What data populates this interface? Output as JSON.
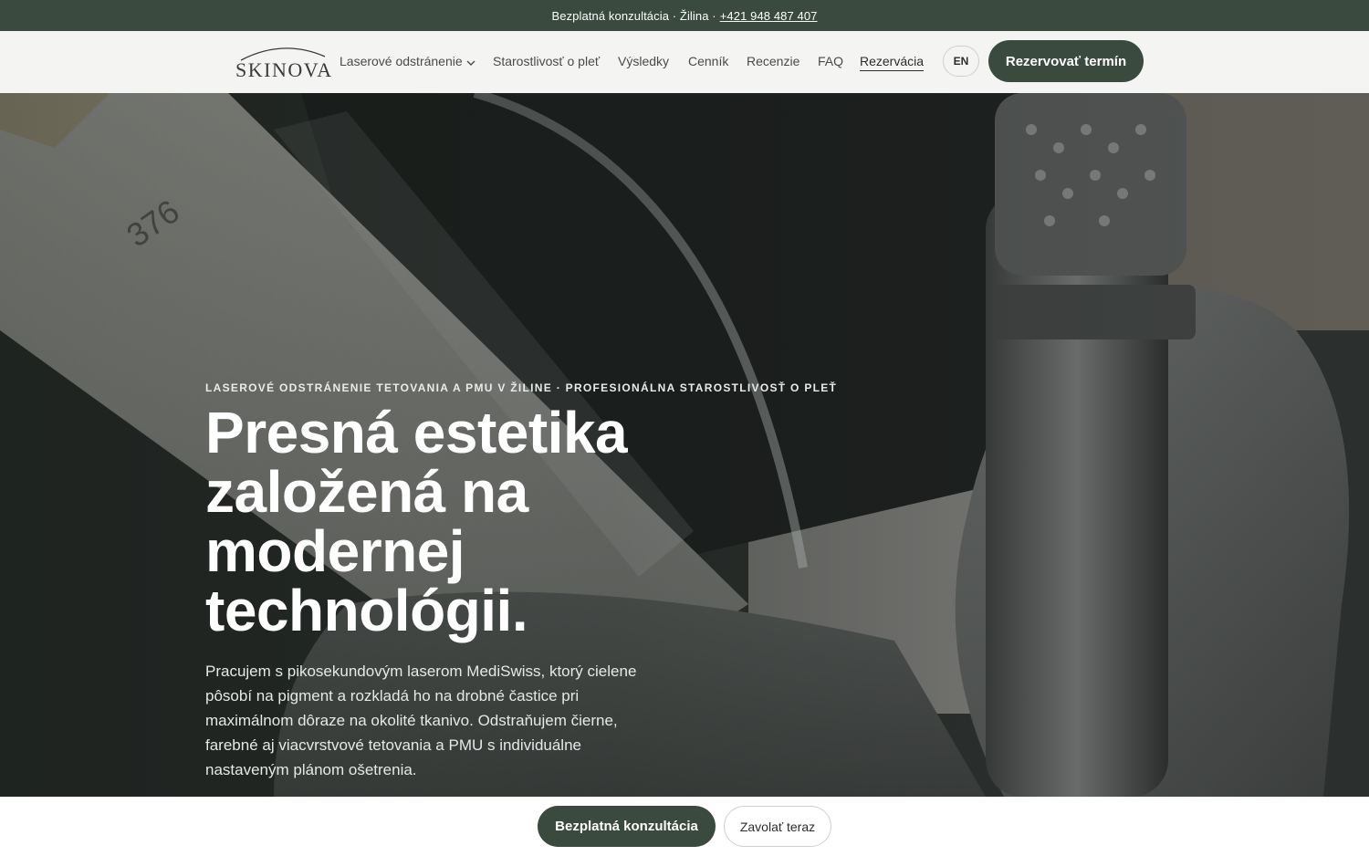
{
  "topbar": {
    "text": "Bezplatná konzultácia · Žilina ·",
    "phone": "+421 948 487 407"
  },
  "brand": {
    "logo_text": "SKINOVA"
  },
  "nav": {
    "items": [
      {
        "label": "Laserové odstránenie",
        "has_dropdown": true
      },
      {
        "label": "Starostlivosť o pleť"
      },
      {
        "label": "Výsledky"
      },
      {
        "label": "Cenník"
      },
      {
        "label": "Recenzie"
      },
      {
        "label": "FAQ"
      },
      {
        "label": "Rezervácia",
        "active": true
      }
    ],
    "lang": "EN",
    "book_label": "Rezervovať termín"
  },
  "hero": {
    "eyebrow": "LASEROVÉ ODSTRÁNENIE TETOVANIA A PMU V ŽILINE · PROFESIONÁLNA STAROSTLIVOSŤ O PLEŤ",
    "headline": "Presná estetika založená na modernej technológii.",
    "lead": "Pracujem s pikosekundovým laserom MediSwiss, ktorý cielene pôsobí na pigment a rozkladá ho na drobné častice pri maximálnom dôraze na okolité tkanivo. Odstraňujem čierne, farebné aj viacvrstvové tetovania a PMU s individuálne nastaveným plánom ošetrenia.",
    "image_engraving": "376"
  },
  "bottom_cta": {
    "primary": "Bezplatná konzultácia",
    "secondary": "Zavolať teraz"
  },
  "colors": {
    "brand_green": "#3b4a3f",
    "nav_bg": "#f4f4f2",
    "text_dark": "#2c2c2c"
  }
}
